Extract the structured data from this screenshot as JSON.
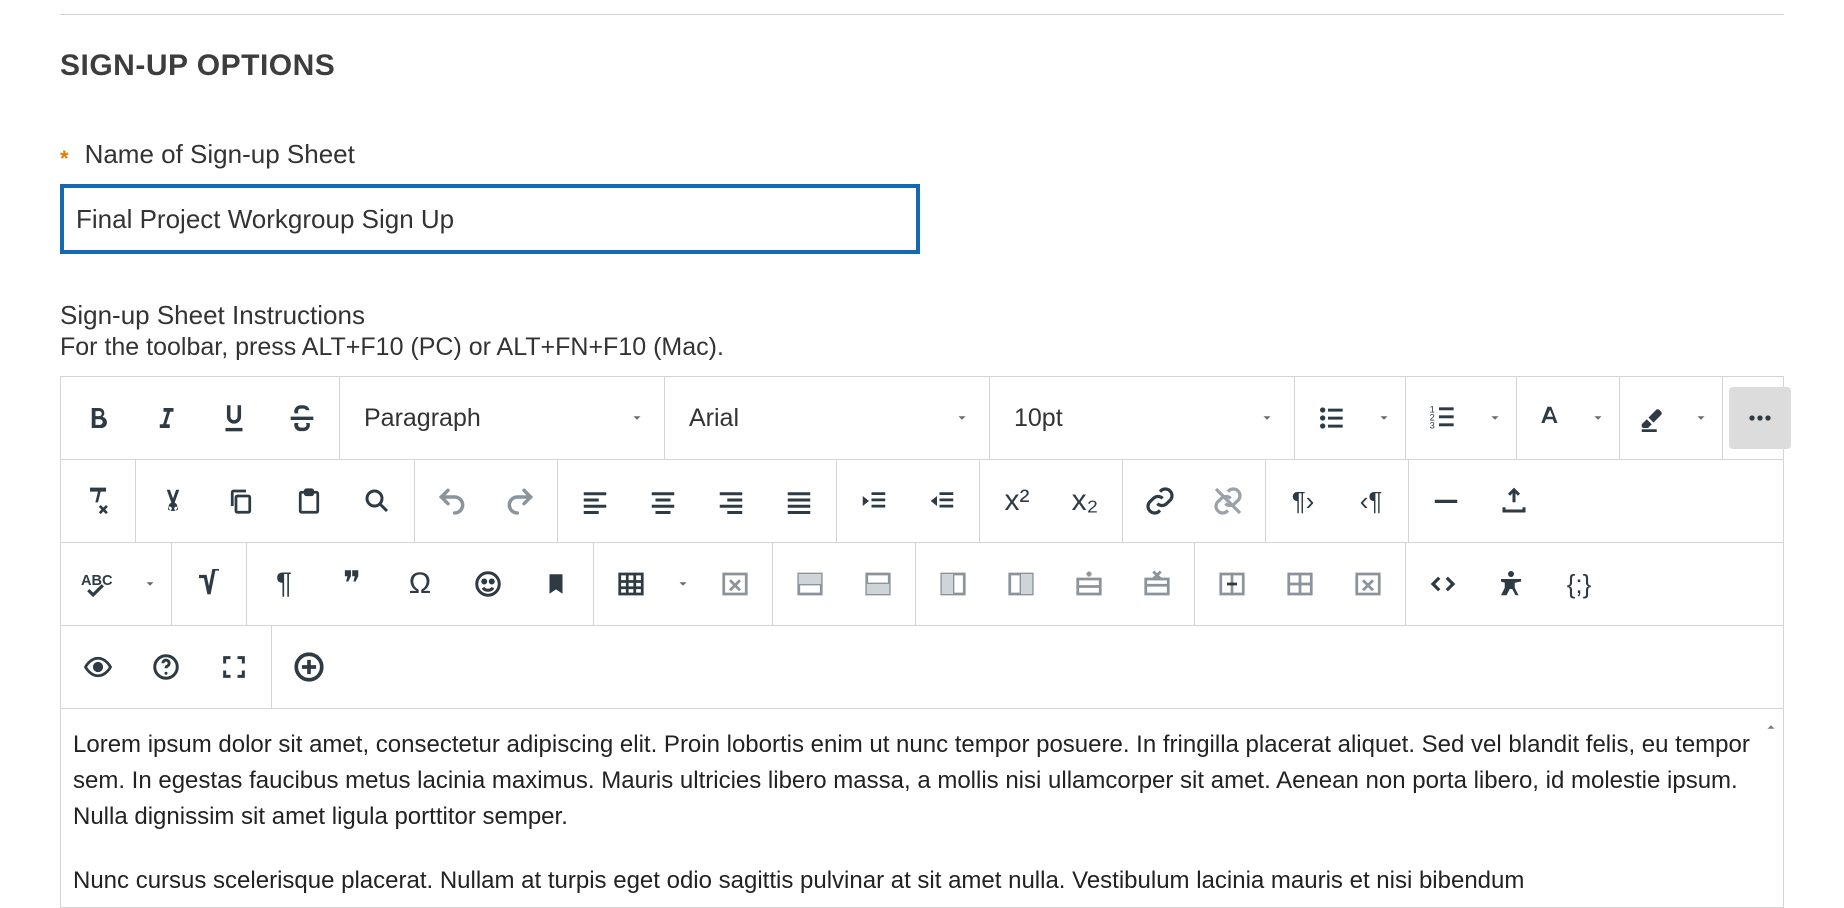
{
  "heading": "SIGN-UP OPTIONS",
  "name_field": {
    "required_mark": "*",
    "label": "Name of Sign-up Sheet",
    "value": "Final Project Workgroup Sign Up"
  },
  "instructions_field": {
    "label": "Sign-up Sheet Instructions",
    "hint": "For the toolbar, press ALT+F10 (PC) or ALT+FN+F10 (Mac)."
  },
  "editor": {
    "block_format": "Paragraph",
    "font_family": "Arial",
    "font_size": "10pt",
    "content_paras": [
      "Lorem ipsum dolor sit amet, consectetur adipiscing elit. Proin lobortis enim ut nunc tempor posuere. In fringilla placerat aliquet. Sed vel blandit felis, eu tempor sem. In egestas faucibus metus lacinia maximus. Mauris ultricies libero massa, a mollis nisi ullamcorper sit amet. Aenean non porta libero, id molestie ipsum. Nulla dignissim sit amet ligula porttitor semper.",
      "Nunc cursus scelerisque placerat. Nullam at turpis eget odio sagittis pulvinar at sit amet nulla. Vestibulum lacinia mauris et nisi bibendum"
    ]
  }
}
